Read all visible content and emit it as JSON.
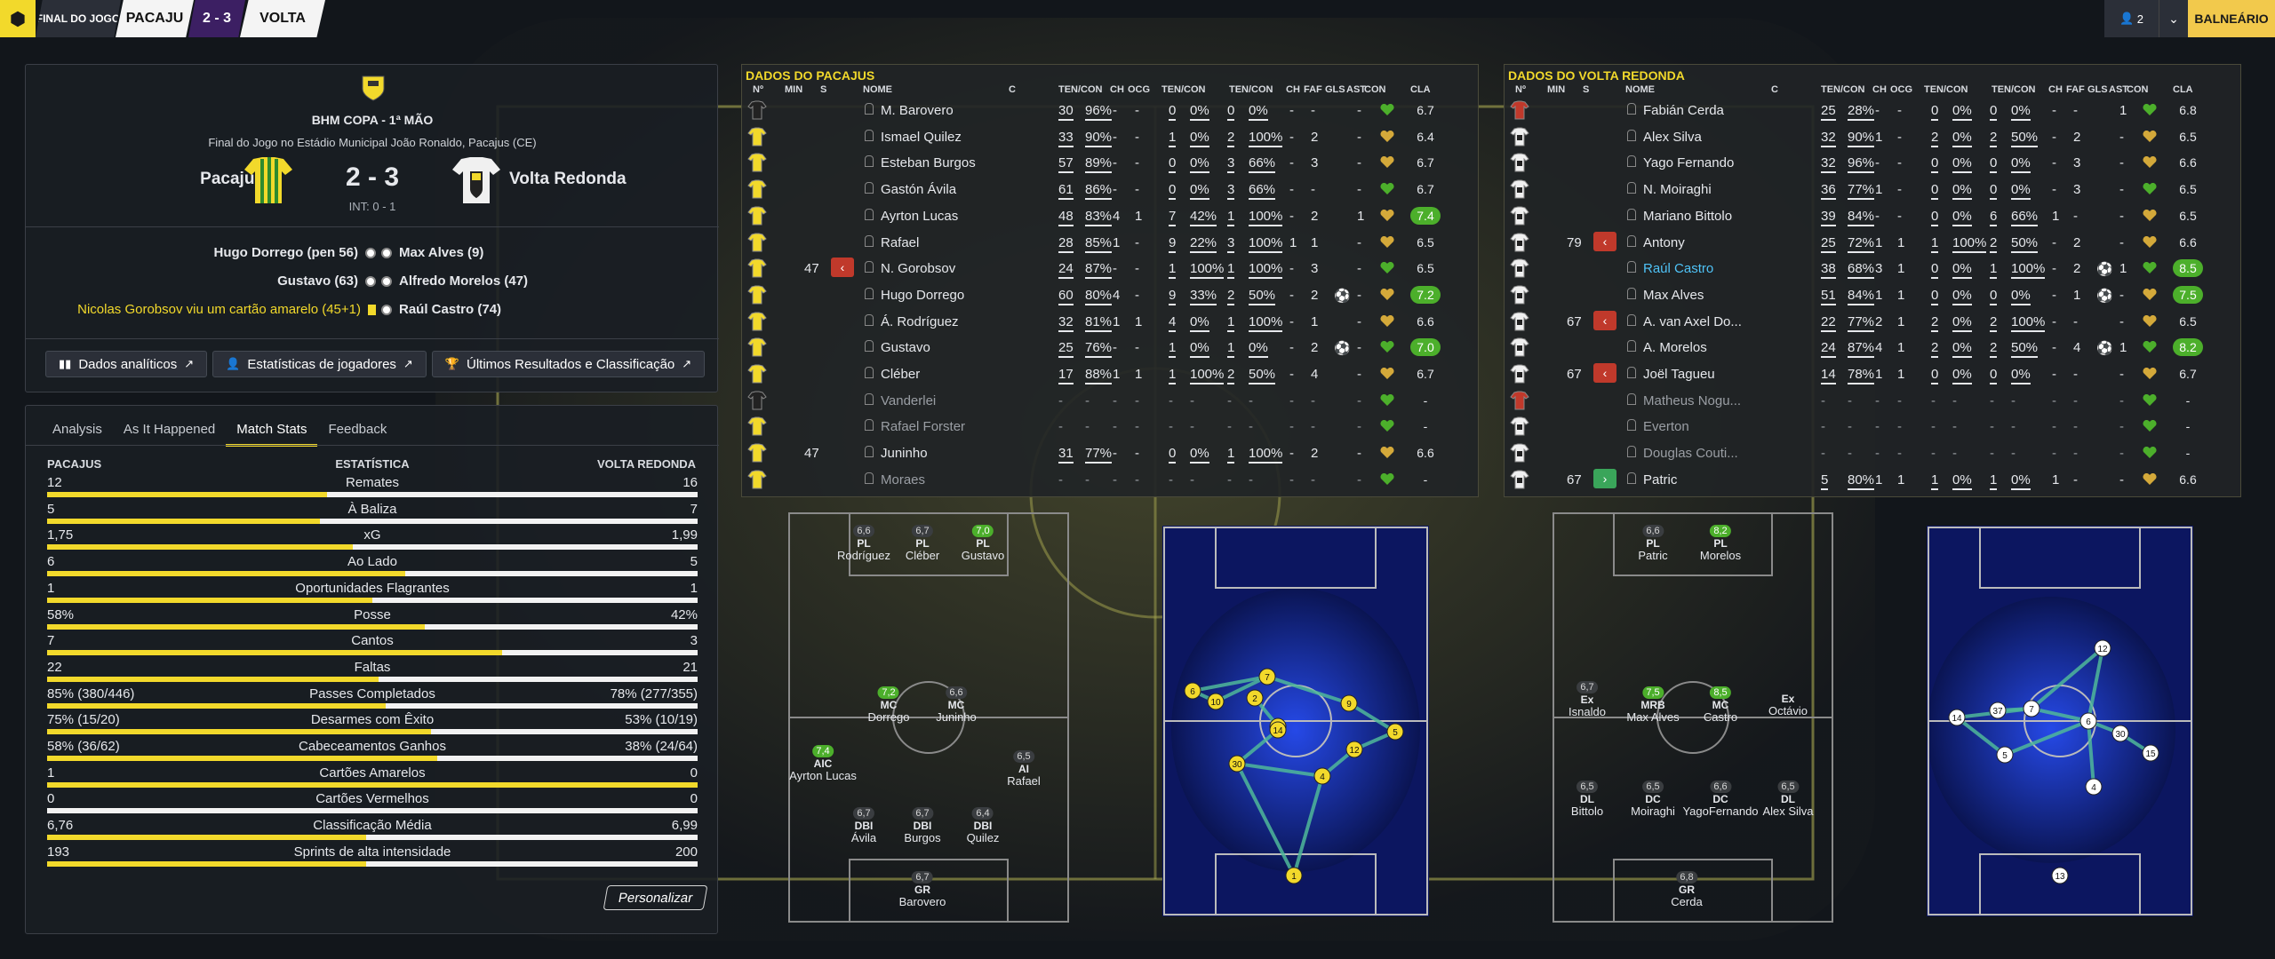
{
  "topbar": {
    "final": "FINAL DO JOGO",
    "home": "PACAJU",
    "score": "2 - 3",
    "away": "VOLTA"
  },
  "topright": {
    "managers": "2",
    "button": "BALNEÁRIO"
  },
  "summary": {
    "competition": "BHM COPA - 1ª MÃO",
    "venue": "Final do Jogo no Estádio Municipal João Ronaldo, Pacajus (CE)",
    "home": "Pacajus",
    "away": "Volta Redonda",
    "score": "2 - 3",
    "interval": "INT: 0 - 1",
    "home_events": [
      "Hugo Dorrego (pen 56)",
      "Gustavo (63)",
      "Nicolas Gorobsov viu um cartão amarelo (45+1)"
    ],
    "away_events": [
      "Max Alves (9)",
      "Alfredo Morelos (47)",
      "Raúl Castro (74)"
    ],
    "buttons": [
      "Dados analíticos",
      "Estatísticas de jogadores",
      "Últimos Resultados e Classificação"
    ]
  },
  "stats": {
    "tabs": [
      "Analysis",
      "As It Happened",
      "Match Stats",
      "Feedback"
    ],
    "head": {
      "home": "PACAJUS",
      "mid": "ESTATÍSTICA",
      "away": "VOLTA REDONDA"
    },
    "rows": [
      {
        "l": "12",
        "n": "Remates",
        "r": "16",
        "f": 0.43
      },
      {
        "l": "5",
        "n": "À Baliza",
        "r": "7",
        "f": 0.42
      },
      {
        "l": "1,75",
        "n": "xG",
        "r": "1,99",
        "f": 0.47
      },
      {
        "l": "6",
        "n": "Ao Lado",
        "r": "5",
        "f": 0.55
      },
      {
        "l": "1",
        "n": "Oportunidades Flagrantes",
        "r": "1",
        "f": 0.5
      },
      {
        "l": "58%",
        "n": "Posse",
        "r": "42%",
        "f": 0.58
      },
      {
        "l": "7",
        "n": "Cantos",
        "r": "3",
        "f": 0.7
      },
      {
        "l": "22",
        "n": "Faltas",
        "r": "21",
        "f": 0.51
      },
      {
        "l": "85% (380/446)",
        "n": "Passes Completados",
        "r": "78% (277/355)",
        "f": 0.52
      },
      {
        "l": "75% (15/20)",
        "n": "Desarmes com Êxito",
        "r": "53% (10/19)",
        "f": 0.59
      },
      {
        "l": "58% (36/62)",
        "n": "Cabeceamentos Ganhos",
        "r": "38% (24/64)",
        "f": 0.6
      },
      {
        "l": "1",
        "n": "Cartões Amarelos",
        "r": "0",
        "f": 1
      },
      {
        "l": "0",
        "n": "Cartões Vermelhos",
        "r": "0",
        "f": 0
      },
      {
        "l": "6,76",
        "n": "Classificação Média",
        "r": "6,99",
        "f": 0.49
      },
      {
        "l": "193",
        "n": "Sprints de alta intensidade",
        "r": "200",
        "f": 0.49
      }
    ],
    "customize": "Personalizar"
  },
  "cols": {
    "n": "Nº",
    "min": "MIN",
    "s": "S",
    "name": "NOME",
    "c": "C",
    "tc1": "TEN/CON",
    "ch1": "CH",
    "ocg": "OCG",
    "tc2": "TEN/CON",
    "tc3": "TEN/CON",
    "ch2": "CH",
    "faf": "FAF",
    "gls": "GLS",
    "ast": "AST",
    "con": "CON",
    "cla": "CLA"
  },
  "home_table": {
    "title": "DADOS DO PACAJUS",
    "players": [
      {
        "name": "M. Barovero",
        "a": "30",
        "ap": "96%",
        "ch": "-",
        "ocg": "-",
        "b": "0",
        "bp": "0%",
        "c": "0",
        "cp": "0%",
        "ch2": "-",
        "faf": "-",
        "gls": "",
        "ast": "-",
        "cla": "6.7",
        "gk": true
      },
      {
        "name": "Ismael Quilez",
        "a": "33",
        "ap": "90%",
        "ch": "-",
        "ocg": "-",
        "b": "1",
        "bp": "0%",
        "c": "2",
        "cp": "100%",
        "ch2": "-",
        "faf": "2",
        "gls": "",
        "ast": "-",
        "cla": "6.4"
      },
      {
        "name": "Esteban Burgos",
        "a": "57",
        "ap": "89%",
        "ch": "-",
        "ocg": "-",
        "b": "0",
        "bp": "0%",
        "c": "3",
        "cp": "66%",
        "ch2": "-",
        "faf": "3",
        "gls": "",
        "ast": "-",
        "cla": "6.7"
      },
      {
        "name": "Gastón Ávila",
        "a": "61",
        "ap": "86%",
        "ch": "-",
        "ocg": "-",
        "b": "0",
        "bp": "0%",
        "c": "3",
        "cp": "66%",
        "ch2": "-",
        "faf": "-",
        "gls": "",
        "ast": "-",
        "cla": "6.7"
      },
      {
        "name": "Ayrton Lucas",
        "a": "48",
        "ap": "83%",
        "ch": "4",
        "ocg": "1",
        "b": "7",
        "bp": "42%",
        "c": "1",
        "cp": "100%",
        "ch2": "-",
        "faf": "2",
        "gls": "",
        "ast": "1",
        "cla": "7.4",
        "green": true
      },
      {
        "name": "Rafael",
        "a": "28",
        "ap": "85%",
        "ch": "1",
        "ocg": "-",
        "b": "9",
        "bp": "22%",
        "c": "3",
        "cp": "100%",
        "ch2": "1",
        "faf": "1",
        "gls": "",
        "ast": "-",
        "cla": "6.5"
      },
      {
        "name": "N. Gorobsov",
        "min": "47",
        "a": "24",
        "ap": "87%",
        "ch": "-",
        "ocg": "-",
        "b": "1",
        "bp": "100%",
        "c": "1",
        "cp": "100%",
        "ch2": "-",
        "faf": "3",
        "gls": "",
        "ast": "-",
        "cla": "6.5",
        "off": true
      },
      {
        "name": "Hugo Dorrego",
        "a": "60",
        "ap": "80%",
        "ch": "4",
        "ocg": "-",
        "b": "9",
        "bp": "33%",
        "c": "2",
        "cp": "50%",
        "ch2": "-",
        "faf": "2",
        "gls": "⚽",
        "ast": "-",
        "cla": "7.2",
        "green": true
      },
      {
        "name": "Á. Rodríguez",
        "a": "32",
        "ap": "81%",
        "ch": "1",
        "ocg": "1",
        "b": "4",
        "bp": "0%",
        "c": "1",
        "cp": "100%",
        "ch2": "-",
        "faf": "1",
        "gls": "",
        "ast": "-",
        "cla": "6.6"
      },
      {
        "name": "Gustavo",
        "a": "25",
        "ap": "76%",
        "ch": "-",
        "ocg": "-",
        "b": "1",
        "bp": "0%",
        "c": "1",
        "cp": "0%",
        "ch2": "-",
        "faf": "2",
        "gls": "⚽",
        "ast": "-",
        "cla": "7.0",
        "green": true
      },
      {
        "name": "Cléber",
        "a": "17",
        "ap": "88%",
        "ch": "1",
        "ocg": "1",
        "b": "1",
        "bp": "100%",
        "c": "2",
        "cp": "50%",
        "ch2": "-",
        "faf": "4",
        "gls": "",
        "ast": "-",
        "cla": "6.7"
      },
      {
        "name": "Vanderlei",
        "a": "-",
        "ap": "-",
        "ch": "-",
        "ocg": "-",
        "b": "-",
        "bp": "-",
        "c": "-",
        "cp": "-",
        "ch2": "-",
        "faf": "-",
        "gls": "",
        "ast": "-",
        "cla": "-",
        "sub": true,
        "gk": true
      },
      {
        "name": "Rafael Forster",
        "a": "-",
        "ap": "-",
        "ch": "-",
        "ocg": "-",
        "b": "-",
        "bp": "-",
        "c": "-",
        "cp": "-",
        "ch2": "-",
        "faf": "-",
        "gls": "",
        "ast": "-",
        "cla": "-",
        "sub": true
      },
      {
        "name": "Juninho",
        "min": "47",
        "a": "31",
        "ap": "77%",
        "ch": "-",
        "ocg": "-",
        "b": "0",
        "bp": "0%",
        "c": "1",
        "cp": "100%",
        "ch2": "-",
        "faf": "2",
        "gls": "",
        "ast": "-",
        "cla": "6.6"
      },
      {
        "name": "Moraes",
        "a": "-",
        "ap": "-",
        "ch": "-",
        "ocg": "-",
        "b": "-",
        "bp": "-",
        "c": "-",
        "cp": "-",
        "ch2": "-",
        "faf": "-",
        "gls": "",
        "ast": "-",
        "cla": "-",
        "sub": true
      }
    ]
  },
  "away_table": {
    "title": "DADOS DO VOLTA REDONDA",
    "players": [
      {
        "name": "Fabián Cerda",
        "a": "25",
        "ap": "28%",
        "ch": "-",
        "ocg": "-",
        "b": "0",
        "bp": "0%",
        "c": "0",
        "cp": "0%",
        "ch2": "-",
        "faf": "-",
        "gls": "",
        "ast": "1",
        "cla": "6.8",
        "gk": true
      },
      {
        "name": "Alex Silva",
        "a": "32",
        "ap": "90%",
        "ch": "1",
        "ocg": "-",
        "b": "2",
        "bp": "0%",
        "c": "2",
        "cp": "50%",
        "ch2": "-",
        "faf": "2",
        "gls": "",
        "ast": "-",
        "cla": "6.5"
      },
      {
        "name": "Yago Fernando",
        "a": "32",
        "ap": "96%",
        "ch": "-",
        "ocg": "-",
        "b": "0",
        "bp": "0%",
        "c": "0",
        "cp": "0%",
        "ch2": "-",
        "faf": "3",
        "gls": "",
        "ast": "-",
        "cla": "6.6"
      },
      {
        "name": "N. Moiraghi",
        "a": "36",
        "ap": "77%",
        "ch": "1",
        "ocg": "-",
        "b": "0",
        "bp": "0%",
        "c": "0",
        "cp": "0%",
        "ch2": "-",
        "faf": "3",
        "gls": "",
        "ast": "-",
        "cla": "6.5"
      },
      {
        "name": "Mariano Bittolo",
        "a": "39",
        "ap": "84%",
        "ch": "-",
        "ocg": "-",
        "b": "0",
        "bp": "0%",
        "c": "6",
        "cp": "66%",
        "ch2": "1",
        "faf": "-",
        "gls": "",
        "ast": "-",
        "cla": "6.5"
      },
      {
        "name": "Antony",
        "min": "79",
        "a": "25",
        "ap": "72%",
        "ch": "1",
        "ocg": "1",
        "b": "1",
        "bp": "100%",
        "c": "2",
        "cp": "50%",
        "ch2": "-",
        "faf": "2",
        "gls": "",
        "ast": "-",
        "cla": "6.6",
        "off": true
      },
      {
        "name": "Raúl Castro",
        "a": "38",
        "ap": "68%",
        "ch": "3",
        "ocg": "1",
        "b": "0",
        "bp": "0%",
        "c": "1",
        "cp": "100%",
        "ch2": "-",
        "faf": "2",
        "gls": "⚽",
        "ast": "1",
        "cla": "8.5",
        "green": true,
        "hl": true
      },
      {
        "name": "Max Alves",
        "a": "51",
        "ap": "84%",
        "ch": "1",
        "ocg": "1",
        "b": "0",
        "bp": "0%",
        "c": "0",
        "cp": "0%",
        "ch2": "-",
        "faf": "1",
        "gls": "⚽",
        "ast": "-",
        "cla": "7.5",
        "green": true
      },
      {
        "name": "A. van Axel Do...",
        "min": "67",
        "a": "22",
        "ap": "77%",
        "ch": "2",
        "ocg": "1",
        "b": "2",
        "bp": "0%",
        "c": "2",
        "cp": "100%",
        "ch2": "-",
        "faf": "-",
        "gls": "",
        "ast": "-",
        "cla": "6.5",
        "off": true
      },
      {
        "name": "A. Morelos",
        "a": "24",
        "ap": "87%",
        "ch": "4",
        "ocg": "1",
        "b": "2",
        "bp": "0%",
        "c": "2",
        "cp": "50%",
        "ch2": "-",
        "faf": "4",
        "gls": "⚽",
        "ast": "1",
        "cla": "8.2",
        "green": true
      },
      {
        "name": "Joël Tagueu",
        "min": "67",
        "a": "14",
        "ap": "78%",
        "ch": "1",
        "ocg": "1",
        "b": "0",
        "bp": "0%",
        "c": "0",
        "cp": "0%",
        "ch2": "-",
        "faf": "-",
        "gls": "",
        "ast": "-",
        "cla": "6.7",
        "off": true
      },
      {
        "name": "Matheus Nogu...",
        "a": "-",
        "ap": "-",
        "ch": "-",
        "ocg": "-",
        "b": "-",
        "bp": "-",
        "c": "-",
        "cp": "-",
        "ch2": "-",
        "faf": "-",
        "gls": "",
        "ast": "-",
        "cla": "-",
        "sub": true,
        "gk": true
      },
      {
        "name": "Everton",
        "a": "-",
        "ap": "-",
        "ch": "-",
        "ocg": "-",
        "b": "-",
        "bp": "-",
        "c": "-",
        "cp": "-",
        "ch2": "-",
        "faf": "-",
        "gls": "",
        "ast": "-",
        "cla": "-",
        "sub": true
      },
      {
        "name": "Douglas Couti...",
        "a": "-",
        "ap": "-",
        "ch": "-",
        "ocg": "-",
        "b": "-",
        "bp": "-",
        "c": "-",
        "cp": "-",
        "ch2": "-",
        "faf": "-",
        "gls": "",
        "ast": "-",
        "cla": "-",
        "sub": true
      },
      {
        "name": "Patric",
        "min": "67",
        "a": "5",
        "ap": "80%",
        "ch": "1",
        "ocg": "1",
        "b": "1",
        "bp": "0%",
        "c": "1",
        "cp": "0%",
        "ch2": "1",
        "faf": "-",
        "gls": "",
        "ast": "-",
        "cla": "6.6",
        "on": true
      }
    ]
  },
  "home_formation": [
    {
      "r": "6,6",
      "p": "PL",
      "n": "Rodríguez"
    },
    {
      "r": "6,7",
      "p": "PL",
      "n": "Cléber"
    },
    {
      "r": "7,0",
      "p": "PL",
      "n": "Gustavo",
      "g": true
    },
    {
      "r": "7,2",
      "p": "MC",
      "n": "Dorrego",
      "g": true
    },
    {
      "r": "6,6",
      "p": "MC",
      "n": "Juninho"
    },
    {
      "r": "7,4",
      "p": "AIC",
      "n": "Ayrton Lucas",
      "g": true
    },
    {
      "r": "6,5",
      "p": "AI",
      "n": "Rafael"
    },
    {
      "r": "6,7",
      "p": "DBI",
      "n": "Ávila"
    },
    {
      "r": "6,7",
      "p": "DBI",
      "n": "Burgos"
    },
    {
      "r": "6,4",
      "p": "DBI",
      "n": "Quilez"
    },
    {
      "r": "6,7",
      "p": "GR",
      "n": "Barovero"
    }
  ],
  "away_formation": [
    {
      "r": "6,6",
      "p": "PL",
      "n": "Patric"
    },
    {
      "r": "8,2",
      "p": "PL",
      "n": "Morelos",
      "g": true
    },
    {
      "r": "6,7",
      "p": "Ex",
      "n": "Isnaldo"
    },
    {
      "r": "7,5",
      "p": "MRB",
      "n": "Max Alves",
      "g": true
    },
    {
      "r": "8,5",
      "p": "MC",
      "n": "Castro",
      "g": true
    },
    {
      "r": "",
      "p": "Ex",
      "n": "Octávio"
    },
    {
      "r": "6,5",
      "p": "DL",
      "n": "Bittolo"
    },
    {
      "r": "6,5",
      "p": "DC",
      "n": "Moiraghi"
    },
    {
      "r": "6,6",
      "p": "DC",
      "n": "YagoFernando"
    },
    {
      "r": "6,5",
      "p": "DL",
      "n": "Alex Silva"
    },
    {
      "r": "6,8",
      "p": "GR",
      "n": "Cerda"
    }
  ],
  "home_pass_nodes": [
    "1",
    "6",
    "10",
    "7",
    "9",
    "5",
    "4",
    "11",
    "2",
    "12",
    "30",
    "14"
  ],
  "away_pass_nodes": [
    "12",
    "14",
    "7",
    "37",
    "6",
    "30",
    "5",
    "15",
    "4",
    "13"
  ],
  "colors": {
    "accent": "#f2d92b",
    "home": "#f2d92b",
    "away": "#ffffff",
    "panel": "#1a1e24"
  }
}
